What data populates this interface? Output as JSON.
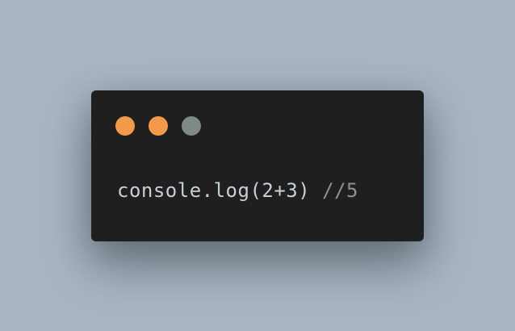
{
  "window": {
    "controls": [
      {
        "name": "close-dot",
        "color": "#f39a4a"
      },
      {
        "name": "minimize-dot",
        "color": "#f39a4a"
      },
      {
        "name": "maximize-dot",
        "color": "#7f8a86"
      }
    ],
    "code": {
      "statement": "console.log(2+3)",
      "comment": " //5"
    }
  },
  "colors": {
    "background": "#a9b6c2",
    "window_bg": "#1f1f1f",
    "code_text": "#c5d0d8",
    "comment_text": "#8a9196"
  }
}
